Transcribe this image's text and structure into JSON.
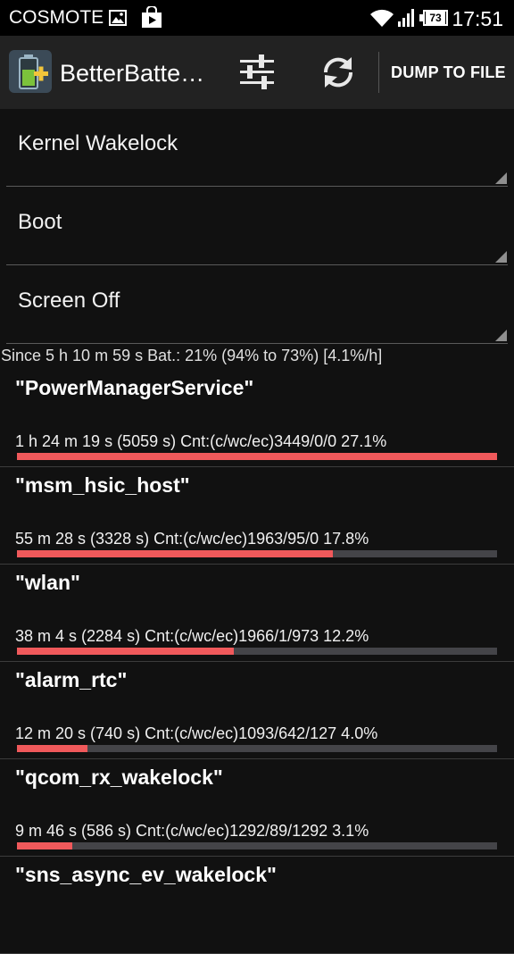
{
  "status_bar": {
    "carrier": "COSMOTE",
    "battery_level": "73",
    "time": "17:51",
    "icons": [
      "image-icon",
      "play-store-icon",
      "wifi-icon",
      "signal-icon",
      "battery-icon"
    ]
  },
  "action_bar": {
    "title": "BetterBatte…",
    "dump_label": "DUMP TO FILE",
    "icons": [
      "app-battery-icon",
      "filter-settings-icon",
      "refresh-icon"
    ]
  },
  "filters": {
    "stat_type": "Kernel Wakelock",
    "reference": "Boot",
    "screen_state": "Screen Off"
  },
  "summary": "Since 5 h 10 m 59 s  Bat.: 21% (94% to 73%) [4.1%/h]",
  "colors": {
    "bar_fill": "#f0595b",
    "bar_track": "#444448",
    "background": "#111111",
    "action_bar": "#222222"
  },
  "wakelocks": [
    {
      "name": "\"PowerManagerService\"",
      "info": "1 h 24 m 19 s  (5059 s) Cnt:(c/wc/ec)3449/0/0 27.1%",
      "fraction": 1.0
    },
    {
      "name": "\"msm_hsic_host\"",
      "info": "55 m 28 s  (3328 s) Cnt:(c/wc/ec)1963/95/0 17.8%",
      "fraction": 0.658
    },
    {
      "name": "\"wlan\"",
      "info": "38 m 4 s  (2284 s) Cnt:(c/wc/ec)1966/1/973 12.2%",
      "fraction": 0.451
    },
    {
      "name": "\"alarm_rtc\"",
      "info": "12 m 20 s  (740 s) Cnt:(c/wc/ec)1093/642/127 4.0%",
      "fraction": 0.146
    },
    {
      "name": "\"qcom_rx_wakelock\"",
      "info": "9 m 46 s  (586 s) Cnt:(c/wc/ec)1292/89/1292 3.1%",
      "fraction": 0.116
    },
    {
      "name": "\"sns_async_ev_wakelock\"",
      "info": "",
      "fraction": null
    }
  ]
}
